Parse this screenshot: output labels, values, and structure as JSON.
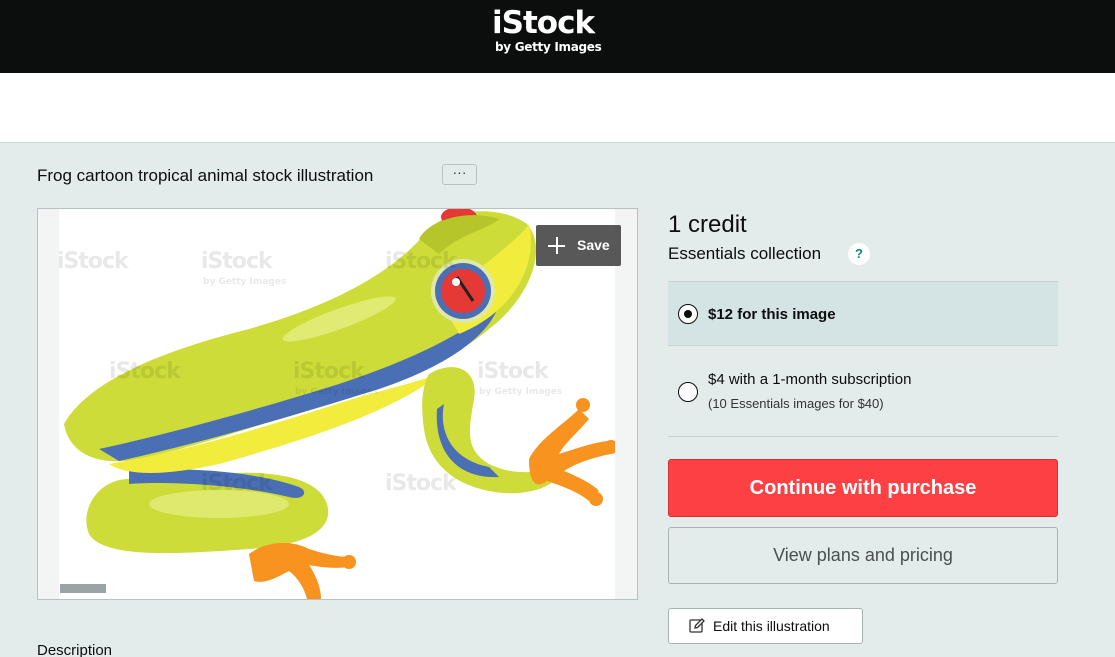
{
  "header": {
    "logo_wordmark": "iStock",
    "logo_subtitle": "by Getty Images"
  },
  "asset": {
    "title": "Frog cartoon tropical animal stock illustration",
    "more_label": "···",
    "save_label": "Save",
    "watermark": "iStock",
    "watermark_sub": "by Getty Images"
  },
  "pricing": {
    "credit": "1 credit",
    "collection": "Essentials collection",
    "help_glyph": "?",
    "options": [
      {
        "label": "$12 for this image",
        "selected": true
      },
      {
        "label": "$4 with a 1-month subscription",
        "sublabel": "(10 Essentials images for $40)",
        "selected": false
      }
    ],
    "purchase_label": "Continue with purchase",
    "plans_label": "View plans and pricing",
    "edit_label": "Edit this illustration"
  },
  "sections": {
    "description_heading": "Description"
  },
  "colors": {
    "accent_red": "#fd4044",
    "page_bg": "#e4ebeb",
    "selected_option_bg": "#d4e3e3",
    "frog_green": "#cddc39",
    "frog_blue": "#4a6fb5",
    "frog_orange": "#f7931e"
  },
  "icons": [
    "plus-icon",
    "help-icon",
    "pencil-icon",
    "radio-selected-icon",
    "radio-unselected-icon"
  ]
}
